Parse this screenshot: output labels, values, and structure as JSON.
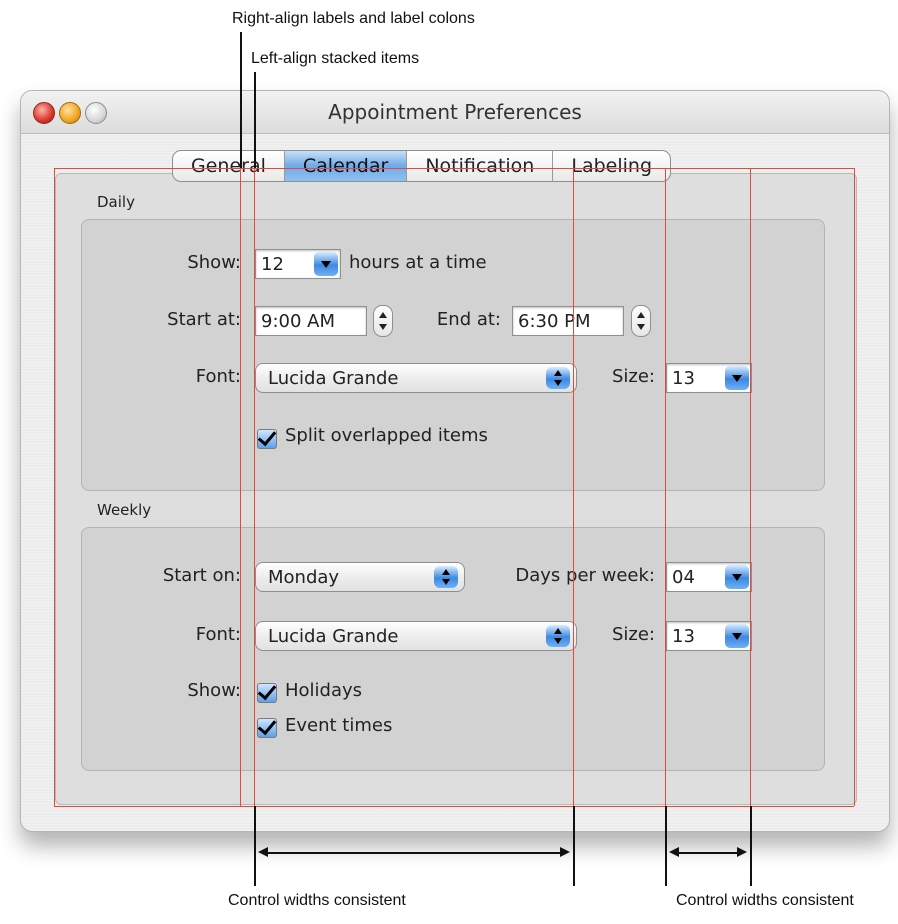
{
  "annotations": {
    "top1": "Right-align labels and label colons",
    "top2": "Left-align stacked items",
    "bottom_left": "Control widths consistent",
    "bottom_right": "Control widths consistent"
  },
  "window": {
    "title": "Appointment Preferences",
    "tabs": [
      {
        "label": "General",
        "selected": false
      },
      {
        "label": "Calendar",
        "selected": true
      },
      {
        "label": "Notification",
        "selected": false
      },
      {
        "label": "Labeling",
        "selected": false
      }
    ]
  },
  "daily": {
    "section_label": "Daily",
    "show_label": "Show:",
    "show_value": "12",
    "show_suffix": "hours at a time",
    "start_label": "Start at:",
    "start_value": "9:00 AM",
    "end_label": "End at:",
    "end_value": "6:30 PM",
    "font_label": "Font:",
    "font_value": "Lucida Grande",
    "size_label": "Size:",
    "size_value": "13",
    "split_label": "Split overlapped items",
    "split_checked": true
  },
  "weekly": {
    "section_label": "Weekly",
    "start_label": "Start on:",
    "start_value": "Monday",
    "days_label": "Days per week:",
    "days_value": "04",
    "font_label": "Font:",
    "font_value": "Lucida Grande",
    "size_label": "Size:",
    "size_value": "13",
    "show_label": "Show:",
    "holidays_label": "Holidays",
    "holidays_checked": true,
    "event_times_label": "Event times",
    "event_times_checked": true
  },
  "colors": {
    "guide": "#e34a3a",
    "selected_tab": "#6fa9e6"
  }
}
